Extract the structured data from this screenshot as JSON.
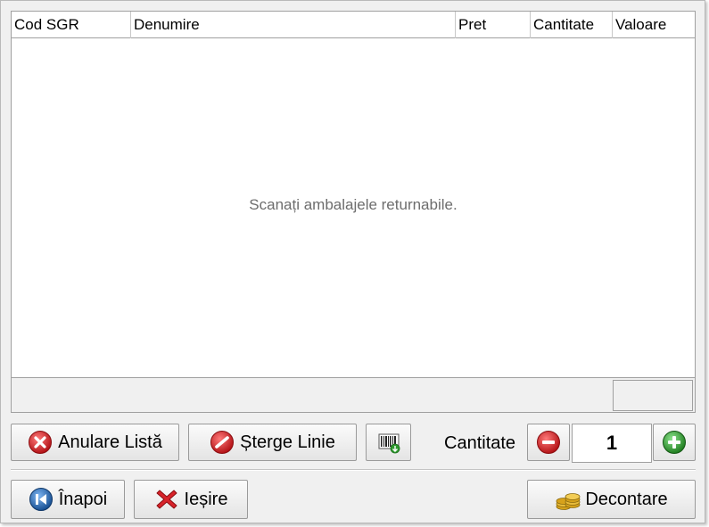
{
  "table": {
    "columns": [
      "Cod SGR",
      "Denumire",
      "Pret",
      "Cantitate",
      "Valoare"
    ],
    "rows": [],
    "empty_message": "Scanați ambalajele returnabile."
  },
  "actions": {
    "cancel_list_label": "Anulare Listă",
    "delete_line_label": "Șterge Linie",
    "quantity_label": "Cantitate",
    "quantity_value": "1",
    "back_label": "Înapoi",
    "exit_label": "Ieșire",
    "settle_label": "Decontare"
  },
  "colors": {
    "danger": "#d8232a",
    "add": "#2e9a2e",
    "nav": "#1f5fa8",
    "coin": "#d7a21b"
  },
  "icons": {
    "cancel_list": "red-x-circle-icon",
    "delete_line": "no-entry-icon",
    "barcode": "barcode-scan-icon",
    "minus": "minus-circle-icon",
    "plus": "plus-circle-icon",
    "back": "back-arrow-icon",
    "exit": "red-x-icon",
    "settle": "coins-icon"
  }
}
